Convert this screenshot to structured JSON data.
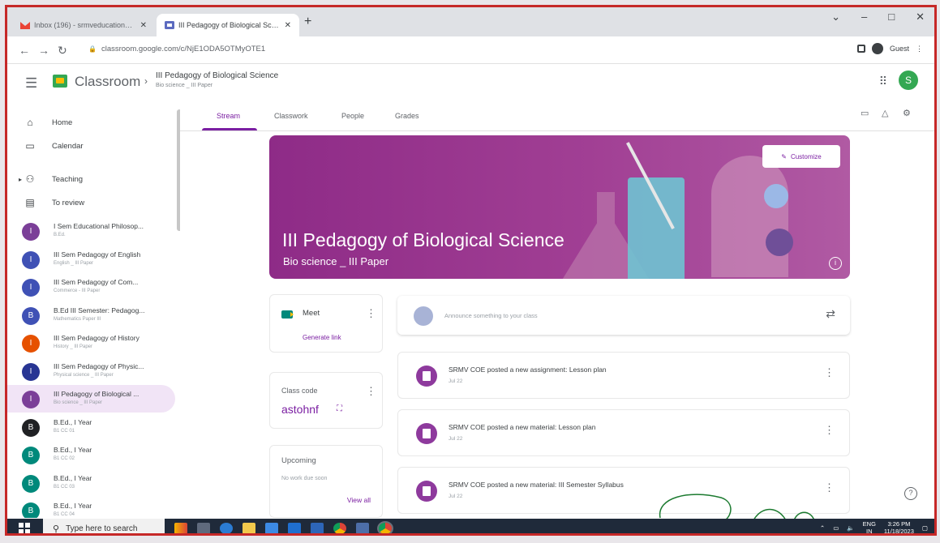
{
  "browser": {
    "tabs": [
      {
        "label": "Inbox (196) - srmveducation@...",
        "icon": "gmail-icon"
      },
      {
        "label": "III Pedagogy of Biological Scie...",
        "icon": "classroom-icon"
      }
    ],
    "url": "classroom.google.com/c/NjE1ODA5OTMyOTE1",
    "profile_label": "Guest",
    "window_controls": {
      "minimize": "–",
      "maximize": "□",
      "close": "✕"
    }
  },
  "header": {
    "app_name": "Classroom",
    "course_title": "III Pedagogy of Biological Science",
    "course_subtitle": "Bio science _ III Paper",
    "avatar_letter": "S",
    "avatar_color": "#34a853"
  },
  "sidebar": {
    "nav": [
      {
        "label": "Home",
        "icon": "home-icon"
      },
      {
        "label": "Calendar",
        "icon": "calendar-icon"
      },
      {
        "label": "Teaching",
        "icon": "people-icon"
      },
      {
        "label": "To review",
        "icon": "inbox-icon"
      }
    ],
    "classes": [
      {
        "letter": "I",
        "name": "I Sem Educational Philosop...",
        "sub": "B.Ed.",
        "color": "#7b3f98"
      },
      {
        "letter": "I",
        "name": "III Sem Pedagogy of English",
        "sub": "English _ III Paper",
        "color": "#3f51b5"
      },
      {
        "letter": "I",
        "name": "III Sem Pedagogy of Com...",
        "sub": "Commerce - III Paper",
        "color": "#3f51b5"
      },
      {
        "letter": "B",
        "name": "B.Ed III Semester: Pedagog...",
        "sub": "Mathematics Paper III",
        "color": "#3f51b5"
      },
      {
        "letter": "I",
        "name": "III Sem Pedagogy of History",
        "sub": "History _ III Paper",
        "color": "#e65100"
      },
      {
        "letter": "I",
        "name": "III Sem Pedagogy of Physic...",
        "sub": "Physical science _ III Paper",
        "color": "#283593"
      },
      {
        "letter": "I",
        "name": "III Pedagogy of Biological ...",
        "sub": "Bio science _ III Paper",
        "color": "#7b3f98",
        "active": true
      },
      {
        "letter": "B",
        "name": "B.Ed., I Year",
        "sub": "B1 CC 01",
        "color": "#202124"
      },
      {
        "letter": "B",
        "name": "B.Ed., I Year",
        "sub": "B1 CC 02",
        "color": "#00897b"
      },
      {
        "letter": "B",
        "name": "B.Ed., I Year",
        "sub": "B1 CC 03",
        "color": "#00897b"
      },
      {
        "letter": "B",
        "name": "B.Ed., I Year",
        "sub": "B1 CC 04",
        "color": "#00897b"
      }
    ]
  },
  "tabs": [
    {
      "label": "Stream",
      "active": true
    },
    {
      "label": "Classwork"
    },
    {
      "label": "People"
    },
    {
      "label": "Grades"
    }
  ],
  "banner": {
    "title": "III Pedagogy of Biological Science",
    "subtitle": "Bio science _ III Paper",
    "customize_label": "Customize",
    "info": "i"
  },
  "meet": {
    "label": "Meet",
    "action": "Generate link"
  },
  "class_code": {
    "label": "Class code",
    "value": "astohnf"
  },
  "upcoming": {
    "label": "Upcoming",
    "empty_text": "No work due soon",
    "view_all": "View all"
  },
  "announce": {
    "placeholder": "Announce something to your class"
  },
  "posts": [
    {
      "title": "SRMV COE posted a new assignment: Lesson plan",
      "date": "Jul 22"
    },
    {
      "title": "SRMV COE posted a new material: Lesson plan",
      "date": "Jul 22"
    },
    {
      "title": "SRMV COE posted a new material: III Semester Syllabus",
      "date": "Jul 22"
    }
  ],
  "taskbar": {
    "search_placeholder": "Type here to search",
    "lang": "ENG",
    "region": "IN",
    "time": "3:26 PM",
    "date": "11/18/2023"
  },
  "colors": {
    "accent": "#7b1fa2",
    "banner": "#a13f94"
  }
}
